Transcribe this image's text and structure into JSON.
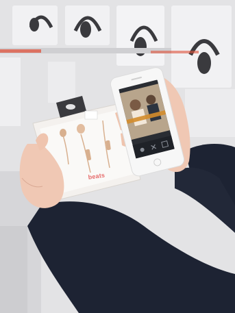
{
  "product": {
    "brand_logo_text": "beats"
  },
  "phone": {
    "status_text": "",
    "screen_caption": ""
  },
  "colors": {
    "wall": "#e4e4e6",
    "shelf_panel": "#f1f1f3",
    "shelf_accent": "#e0533c",
    "headphones": "#3a3a3e",
    "sleeve": "#1d2333",
    "skin": "#f0c8b4",
    "earphone_gold": "#d8b08f",
    "phone_body": "#f7f7f7",
    "phone_screen": "#2a2d33",
    "brand_red": "#e66b6b"
  }
}
